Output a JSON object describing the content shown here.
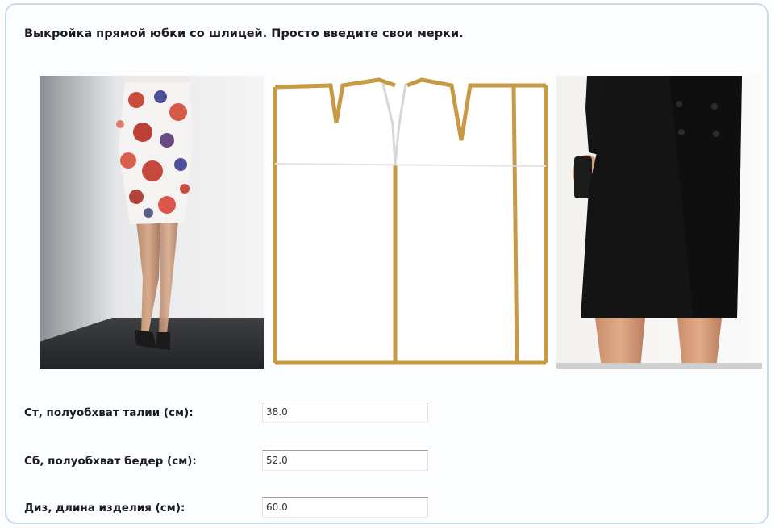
{
  "title": "Выкройка прямой юбки со шлицей. Просто введите свои мерки.",
  "fields": [
    {
      "label": "Ст, полуобхват талии (см):",
      "value": "38.0"
    },
    {
      "label": "Сб, полуобхват бедер (см):",
      "value": "52.0"
    },
    {
      "label": "Диз, длина изделия (см):",
      "value": "60.0"
    }
  ],
  "colors": {
    "frame_border": "#c9daf0",
    "pattern_line": "#c89a46",
    "text": "#1b1b22"
  },
  "images": {
    "left": "floral-pencil-skirt-photo",
    "center": "skirt-pattern-drawing",
    "right": "black-pencil-skirt-photo"
  }
}
